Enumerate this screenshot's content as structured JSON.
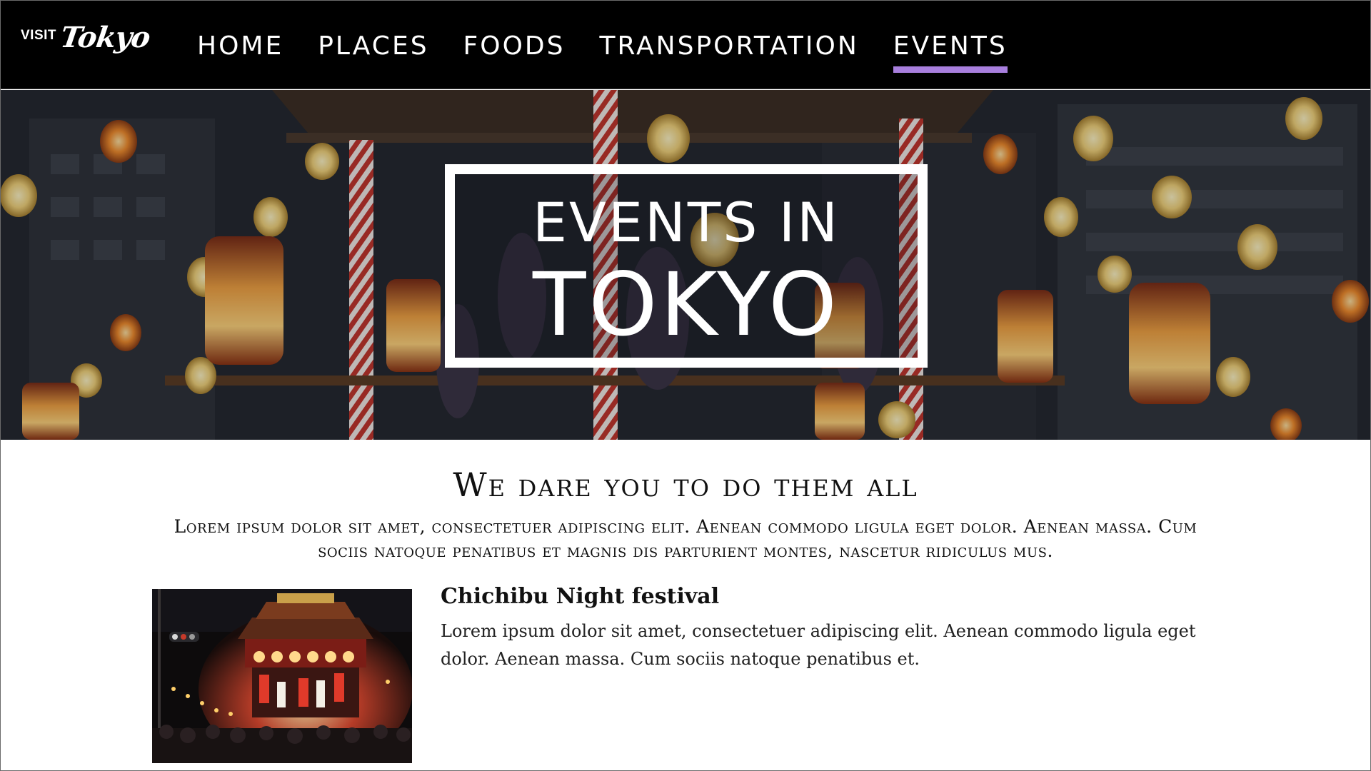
{
  "logo": {
    "visit": "VISIT",
    "tokyo": "Tokyo"
  },
  "nav": {
    "items": [
      {
        "label": "HOME"
      },
      {
        "label": "PLACES"
      },
      {
        "label": "FOODS"
      },
      {
        "label": "TRANSPORTATION"
      },
      {
        "label": "EVENTS",
        "active": true
      }
    ],
    "active_underline_color": "#a87fde"
  },
  "hero": {
    "line1": "EVENTS IN",
    "line2": "TOKYO",
    "image": "night festival with paper lanterns"
  },
  "intro": {
    "title": "We dare you to do them all",
    "lead": "Lorem ipsum dolor sit amet, consectetuer adipiscing elit. Aenean commodo ligula eget dolor. Aenean massa. Cum sociis natoque penatibus et magnis dis parturient montes, nascetur ridiculus mus."
  },
  "events": [
    {
      "title": "Chichibu Night festival",
      "description": "Lorem ipsum dolor sit amet, consectetuer adipiscing elit. Aenean commodo ligula eget dolor. Aenean massa. Cum sociis natoque penatibus et.",
      "image": "festival float at night"
    }
  ]
}
